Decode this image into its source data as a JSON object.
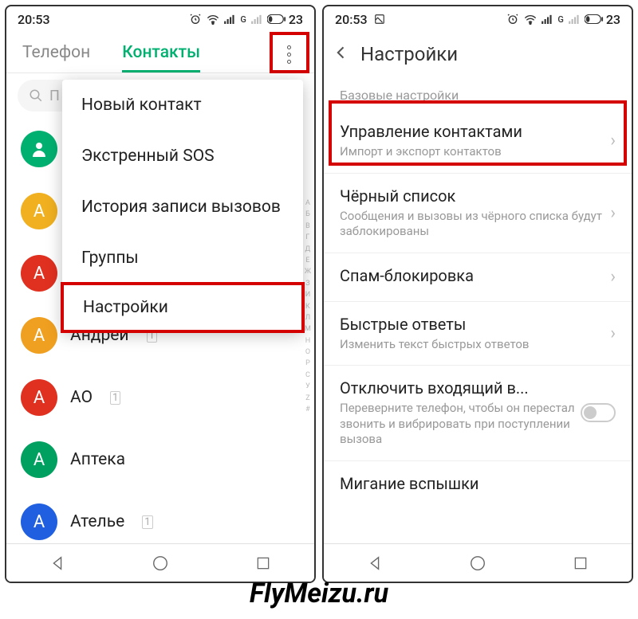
{
  "status": {
    "time": "20:53",
    "battery": "23",
    "signal_g": "G"
  },
  "left": {
    "tabs": {
      "phone": "Телефон",
      "contacts": "Контакты"
    },
    "search_placeholder": "П",
    "menu": {
      "new_contact": "Новый контакт",
      "emergency": "Экстренный SOS",
      "call_history": "История записи вызовов",
      "groups": "Группы",
      "settings": "Настройки"
    },
    "contacts": [
      {
        "letter": "",
        "name": "",
        "color": "green"
      },
      {
        "letter": "A",
        "name": "",
        "color": "yellow"
      },
      {
        "letter": "А",
        "name": "",
        "color": "red"
      },
      {
        "letter": "А",
        "name": "Андрей",
        "color": "orange"
      },
      {
        "letter": "А",
        "name": "АО",
        "color": "red"
      },
      {
        "letter": "А",
        "name": "Аптека",
        "color": "darkgreen"
      },
      {
        "letter": "А",
        "name": "Ателье",
        "color": "blue"
      }
    ],
    "index": "АБВГДЕЖЗИЙКЛМНОПРС"
  },
  "right": {
    "title": "Настройки",
    "section": "Базовые настройки",
    "items": {
      "manage": {
        "title": "Управление контактами",
        "sub": "Импорт и экспорт контактов"
      },
      "blacklist": {
        "title": "Чёрный список",
        "sub": "Сообщения и вызовы из чёрного списка будут заблокированы"
      },
      "spam": {
        "title": "Спам-блокировка"
      },
      "quick": {
        "title": "Быстрые ответы",
        "sub": "Изменить текст быстрых ответов"
      },
      "flip": {
        "title": "Отключить входящий в...",
        "sub": "Переверните телефон, чтобы он перестал звонить и вибрировать при поступлении вызова"
      },
      "flash": {
        "title": "Мигание вспышки"
      }
    }
  },
  "watermark": "FlyMeizu.ru"
}
